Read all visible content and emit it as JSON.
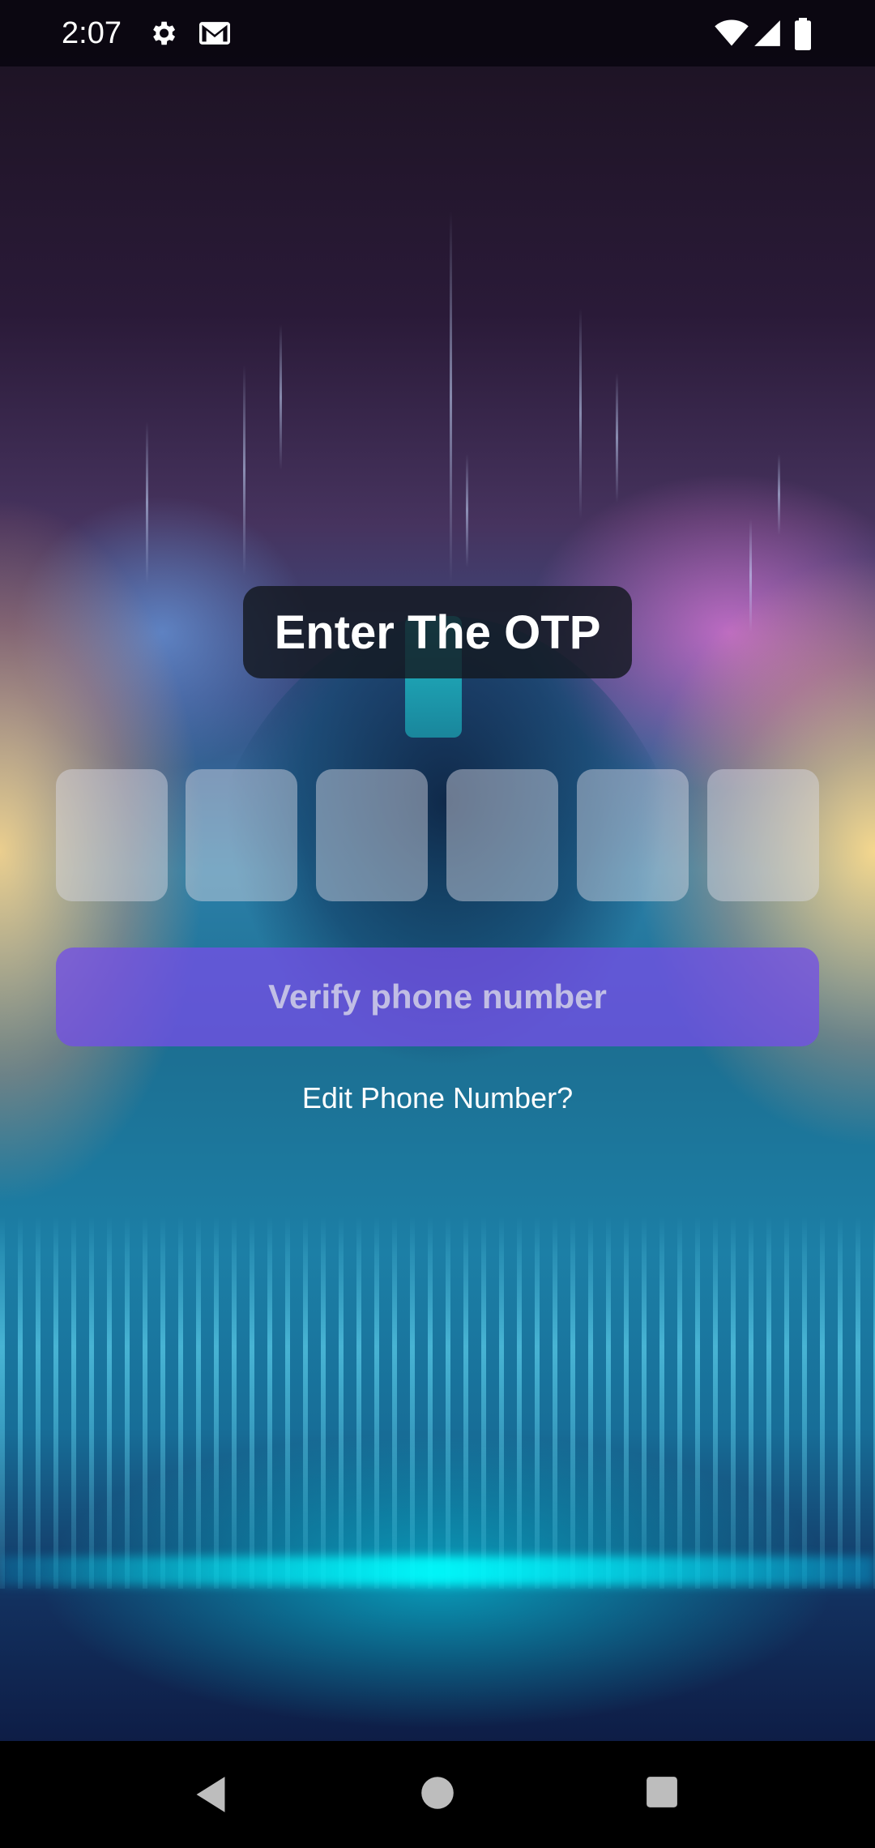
{
  "status_bar": {
    "time": "2:07",
    "icons": [
      "gear-icon",
      "mail-icon",
      "wifi-icon",
      "signal-icon",
      "battery-icon"
    ]
  },
  "screen": {
    "title": "Enter The OTP",
    "otp_boxes": [
      "",
      "",
      "",
      "",
      "",
      ""
    ],
    "verify_button_label": "Verify phone number",
    "edit_link": "Edit Phone Number?"
  },
  "navigation_bar": {
    "icons": [
      "back-icon",
      "home-icon",
      "recents-icon"
    ]
  },
  "colors": {
    "verify_button": "#7350E6",
    "title_pill": "#14191F",
    "otp_box": "#DCDCE6"
  }
}
